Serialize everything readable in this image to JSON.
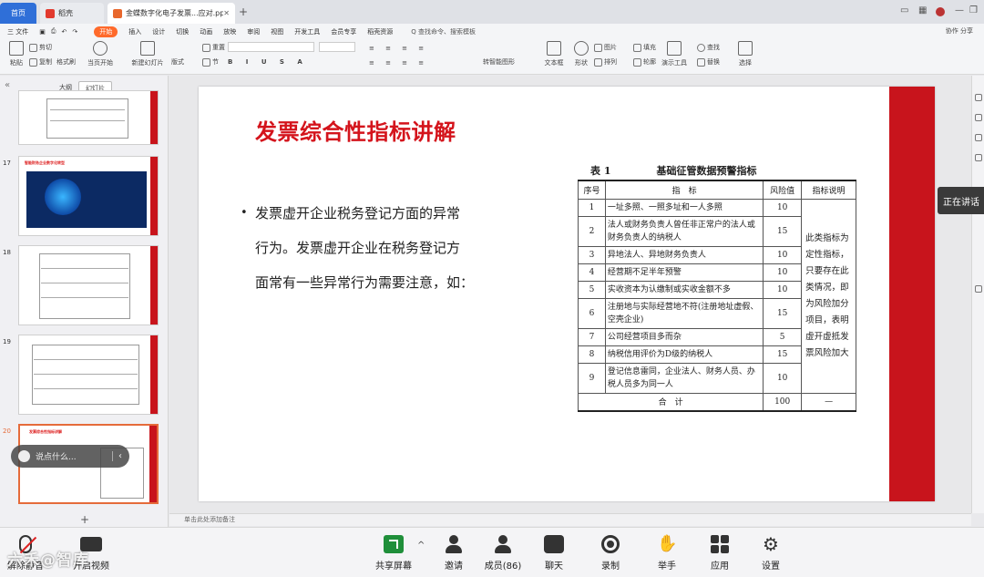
{
  "titlebar": {
    "home_tab": "首页",
    "tab1": "稻壳",
    "tab2": "金蝶数字化电子发票...应对.pptx",
    "new_tab": "+"
  },
  "ribbon": {
    "menus": [
      "三 文件",
      "开始",
      "插入",
      "设计",
      "切换",
      "动画",
      "放映",
      "审阅",
      "视图",
      "开发工具",
      "会员专享",
      "稻壳资源"
    ],
    "active_menu": "开始",
    "search": "Q 查找命令、搜索模板",
    "right_actions": "协作  分享",
    "tools": {
      "paste": "粘贴",
      "cut": "剪切",
      "copy": "复制",
      "format_painter": "格式刷",
      "play": "当页开始",
      "new_slide": "新建幻灯片",
      "layout": "版式",
      "section": "节",
      "reset": "重置",
      "textbox": "文本框",
      "shape": "形状",
      "arrange": "排列",
      "picture": "图片",
      "fill": "填充",
      "outline": "轮廓",
      "find": "查找",
      "replace": "替换",
      "select": "选择",
      "demo_tools": "演示工具",
      "convert": "转智能图形"
    }
  },
  "leftpanel": {
    "tab_outline": "大纲",
    "tab_slides": "幻灯片",
    "slide_numbers": [
      "17",
      "18",
      "19",
      "20"
    ],
    "slide17_title": "智能财务企业数字化转型",
    "slide20_title": "发票综合性指标讲解",
    "add_slide": "+",
    "chat_placeholder": "说点什么..."
  },
  "slide": {
    "title": "发票综合性指标讲解",
    "bullet_lines": [
      "发票虚开企业税务登记方面的异常",
      "行为。发票虚开企业在税务登记方",
      "面常有一些异常行为需要注意，如："
    ],
    "table_caption_label": "表 1",
    "table_caption_title": "基础征管数据预警指标",
    "table_headers": [
      "序号",
      "指　标",
      "风险值",
      "指标说明"
    ],
    "table_rows": [
      {
        "no": "1",
        "name": "一址多照、一照多址和一人多照",
        "risk": "10"
      },
      {
        "no": "2",
        "name": "法人或财务负责人曾任非正常户的法人或财务负责人的纳税人",
        "risk": "15"
      },
      {
        "no": "3",
        "name": "异地法人、异地财务负责人",
        "risk": "10"
      },
      {
        "no": "4",
        "name": "经营期不足半年预警",
        "risk": "10"
      },
      {
        "no": "5",
        "name": "实收资本为认缴制或实收金额不多",
        "risk": "10"
      },
      {
        "no": "6",
        "name": "注册地与实际经营地不符(注册地址虚假、空壳企业)",
        "risk": "15"
      },
      {
        "no": "7",
        "name": "公司经营项目多而杂",
        "risk": "5"
      },
      {
        "no": "8",
        "name": "纳税信用评价为D级的纳税人",
        "risk": "15"
      },
      {
        "no": "9",
        "name": "登记信息雷同，企业法人、财务人员、办税人员多为同一人",
        "risk": "10"
      }
    ],
    "table_note": "此类指标为定性指标，只要存在此类情况，即为风险加分项目，表明虚开虚抵发票风险加大",
    "total_label": "合　计",
    "total_value": "100",
    "total_note": "—"
  },
  "notes_placeholder": "单击此处添加备注",
  "speaking_label": "正在讲话",
  "meeting": {
    "mute": "解除静音",
    "video": "开启视频",
    "share": "共享屏幕",
    "invite": "邀请",
    "members": "成员(86)",
    "chat": "聊天",
    "record": "录制",
    "raise_hand": "举手",
    "apps": "应用",
    "settings": "设置"
  },
  "watermark": "六禾@智库",
  "colors": {
    "accent_red": "#c8141c",
    "title_red": "#d4141c",
    "ribbon_active": "#ff6a2b",
    "share_green": "#1f8f3a"
  }
}
